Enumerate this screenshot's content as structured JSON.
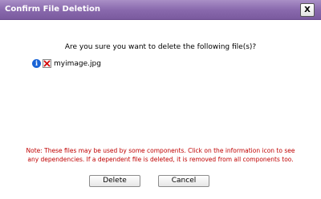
{
  "dialog": {
    "title": "Confirm File Deletion",
    "close_label": "X",
    "question": "Are you sure you want to delete the following file(s)?",
    "files": [
      {
        "name": "myimage.jpg",
        "info_icon": "info-icon",
        "file_icon": "broken-image-icon"
      }
    ],
    "note_line1": "Note: These files may be used by some components. Click on the information icon to see",
    "note_line2": "any dependencies. If a dependent file is deleted, it is removed from all components too.",
    "buttons": {
      "delete_label": "Delete",
      "cancel_label": "Cancel"
    },
    "colors": {
      "titlebar": "#8a6aae",
      "note_text": "#c00000",
      "info_icon": "#1a64d6"
    }
  }
}
